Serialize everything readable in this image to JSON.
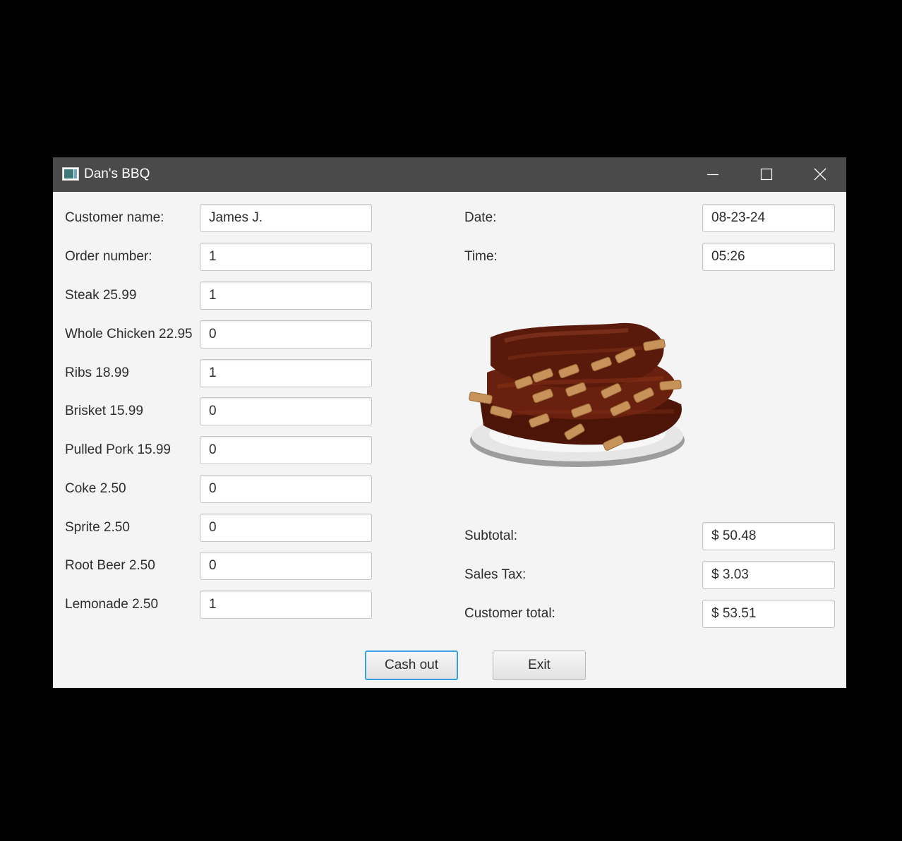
{
  "window": {
    "title": "Dan's BBQ"
  },
  "left_form": [
    {
      "label": "Customer name:",
      "value": "James J."
    },
    {
      "label": "Order number:",
      "value": "1"
    },
    {
      "label": "Steak 25.99",
      "value": "1"
    },
    {
      "label": "Whole Chicken 22.95",
      "value": "0"
    },
    {
      "label": "Ribs 18.99",
      "value": "1"
    },
    {
      "label": "Brisket 15.99",
      "value": "0"
    },
    {
      "label": "Pulled Pork 15.99",
      "value": "0"
    },
    {
      "label": "Coke 2.50",
      "value": "0"
    },
    {
      "label": "Sprite 2.50",
      "value": "0"
    },
    {
      "label": "Root Beer 2.50",
      "value": "0"
    },
    {
      "label": "Lemonade 2.50",
      "value": "1"
    }
  ],
  "right_top": [
    {
      "label": "Date:",
      "value": "08-23-24"
    },
    {
      "label": "Time:",
      "value": "05:26"
    }
  ],
  "totals": [
    {
      "label": "Subtotal:",
      "value": "$ 50.48"
    },
    {
      "label": "Sales Tax:",
      "value": "$ 3.03"
    },
    {
      "label": "Customer total:",
      "value": "$ 53.51"
    }
  ],
  "image": {
    "icon": "ribs-platter-image"
  },
  "buttons": {
    "cash_out": "Cash out",
    "exit": "Exit"
  },
  "colors": {
    "titlebar": "#4a4a4a",
    "background": "#f4f4f4",
    "focus_border": "#39a0e0"
  }
}
